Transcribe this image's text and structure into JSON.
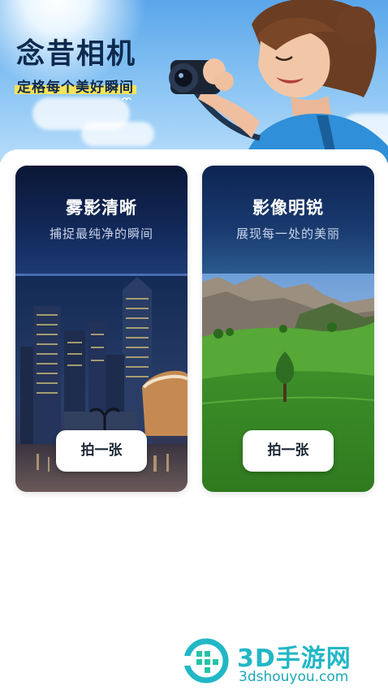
{
  "header": {
    "app_title": "念昔相机",
    "tagline": "定格每个美好瞬间"
  },
  "cards": [
    {
      "title": "雾影清晰",
      "subtitle": "捕捉最纯净的瞬间",
      "button_label": "拍一张",
      "image_subject": "night city skyline"
    },
    {
      "title": "影像明锐",
      "subtitle": "展现每一处的美丽",
      "button_label": "拍一张",
      "image_subject": "green meadow with mountains"
    }
  ],
  "watermark": {
    "name": "3D手游网",
    "url": "3dshouyou.com"
  },
  "colors": {
    "accent_dark": "#0f2a4f",
    "highlight": "#f7e35a",
    "watermark": "#22b7c6"
  }
}
